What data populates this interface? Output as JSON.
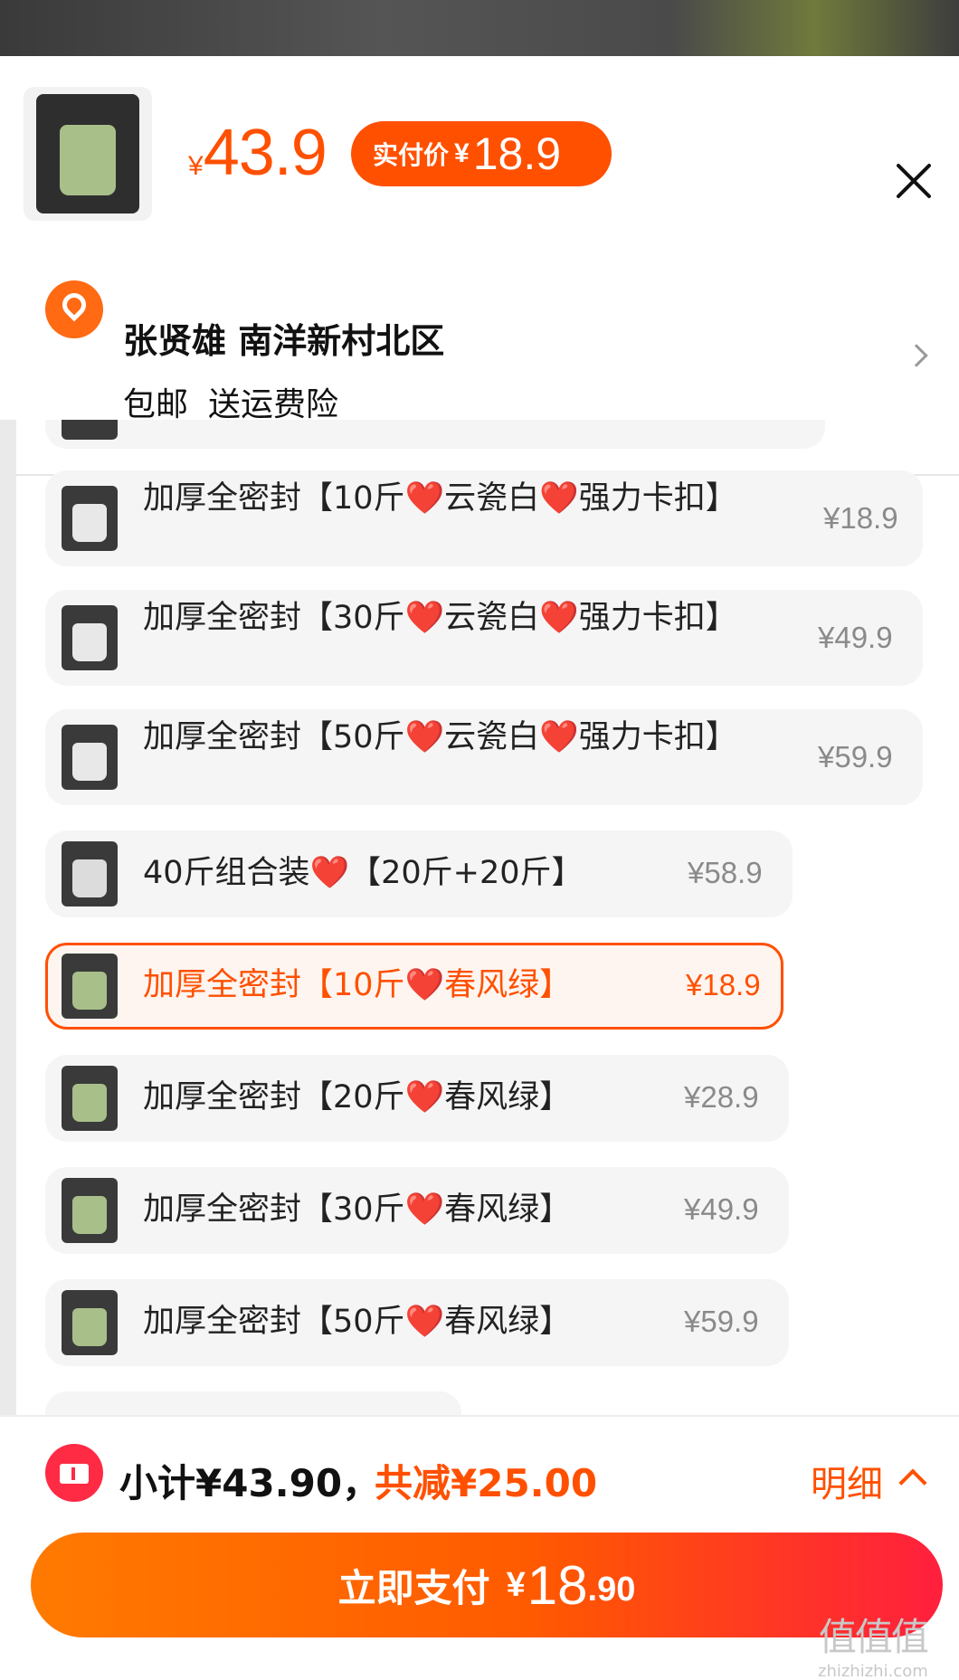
{
  "header": {
    "currency": "¥",
    "price": "43.9",
    "pay_label": "实付价",
    "pay_currency": "¥",
    "pay_amount": "18.9"
  },
  "address": {
    "name_line": "张贤雄 南洋新村北区",
    "tag_1": "包邮",
    "tag_2": "送运费险"
  },
  "options": [
    {
      "name": "加厚全密封【10斤❤️云瓷白❤️强力卡扣】",
      "price": "¥18.9",
      "selected": false,
      "color": "#e8e8e8"
    },
    {
      "name": "加厚全密封【30斤❤️云瓷白❤️强力卡扣】",
      "price": "¥49.9",
      "selected": false,
      "color": "#e8e8e8"
    },
    {
      "name": "加厚全密封【50斤❤️云瓷白❤️强力卡扣】",
      "price": "¥59.9",
      "selected": false,
      "color": "#e8e8e8"
    },
    {
      "name": "40斤组合装❤️【20斤+20斤】",
      "price": "¥58.9",
      "selected": false,
      "color": "#dcdcdc"
    },
    {
      "name": "加厚全密封【10斤❤️春风绿】",
      "price": "¥18.9",
      "selected": true,
      "color": "#a8bf8a"
    },
    {
      "name": "加厚全密封【20斤❤️春风绿】",
      "price": "¥28.9",
      "selected": false,
      "color": "#a8bf8a"
    },
    {
      "name": "加厚全密封【30斤❤️春风绿】",
      "price": "¥49.9",
      "selected": false,
      "color": "#a8bf8a"
    },
    {
      "name": "加厚全密封【50斤❤️春风绿】",
      "price": "¥59.9",
      "selected": false,
      "color": "#a8bf8a"
    }
  ],
  "footer": {
    "subtotal": "小计¥43.90，",
    "reduce": "共减¥25.00",
    "detail": "明细",
    "pay_text": "立即支付",
    "pay_currency": "¥",
    "pay_int": "18",
    "pay_dec": ".90"
  },
  "watermark": {
    "main": "值值值",
    "sub": "zhizhizhi.com"
  },
  "colors": {
    "accent": "#ff5000",
    "coupon": "#ff2a44",
    "green_bucket": "#a8bf8a"
  }
}
